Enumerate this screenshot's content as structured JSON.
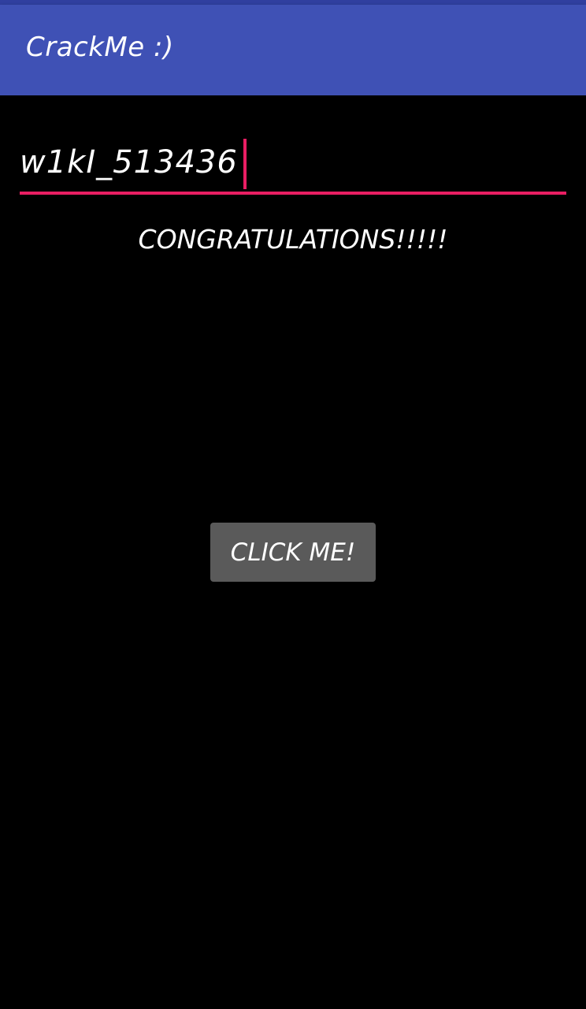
{
  "app_bar": {
    "title": "CrackMe :)",
    "color": "#3f51b5"
  },
  "input": {
    "value": "w1kI_513436",
    "accent_color": "#e91e63"
  },
  "message": {
    "text": "CONGRATULATIONS!!!!!"
  },
  "button": {
    "label": "CLICK ME!",
    "color": "#5a5a5a"
  }
}
